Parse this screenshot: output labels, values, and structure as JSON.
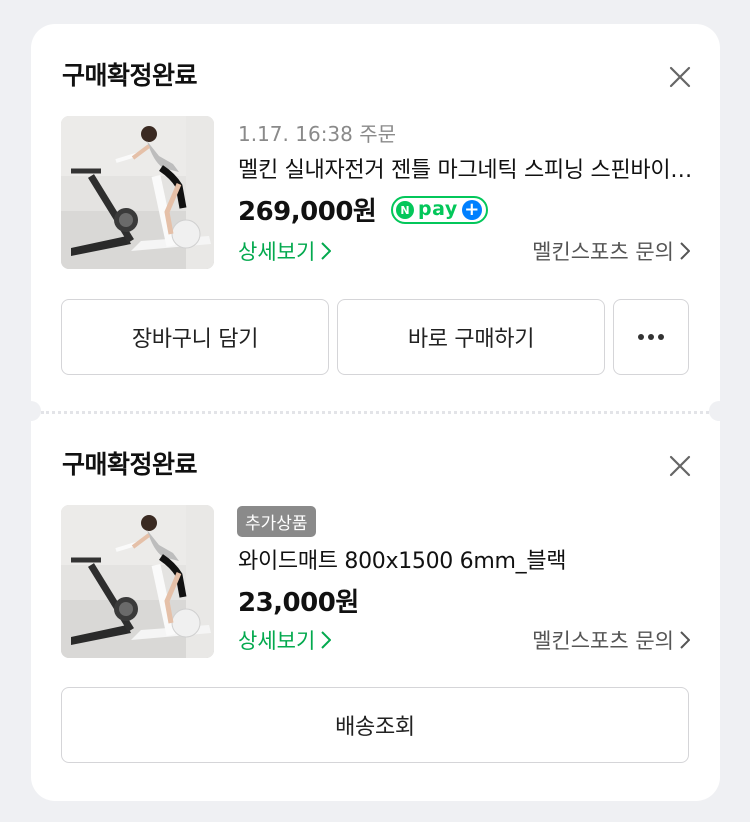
{
  "orders": [
    {
      "status": "구매확정완료",
      "order_meta": "1.17. 16:38 주문",
      "product_name": "멜킨 실내자전거 젠틀 마그네틱 스피닝 스핀바이크 홈트",
      "price": "269,000원",
      "npay_n": "N",
      "npay_label": "pay",
      "npay_plus": "+",
      "detail_link": "상세보기",
      "seller_inquiry": "멜킨스포츠 문의",
      "buttons": {
        "cart": "장바구니 담기",
        "buy": "바로 구매하기",
        "more": "···"
      }
    },
    {
      "status": "구매확정완료",
      "badge": "추가상품",
      "product_name": "와이드매트 800x1500 6mm_블랙",
      "price": "23,000원",
      "detail_link": "상세보기",
      "seller_inquiry": "멜킨스포츠 문의",
      "buttons": {
        "shipping": "배송조회"
      }
    }
  ],
  "icons": {
    "close": "close-icon",
    "chevron": "chevron-right-icon",
    "more": "more-dots-icon"
  },
  "colors": {
    "accent_green": "#03a94e",
    "npay_green": "#03c75a",
    "npay_blue": "#0080ff",
    "badge_gray": "#8a8a8a"
  }
}
